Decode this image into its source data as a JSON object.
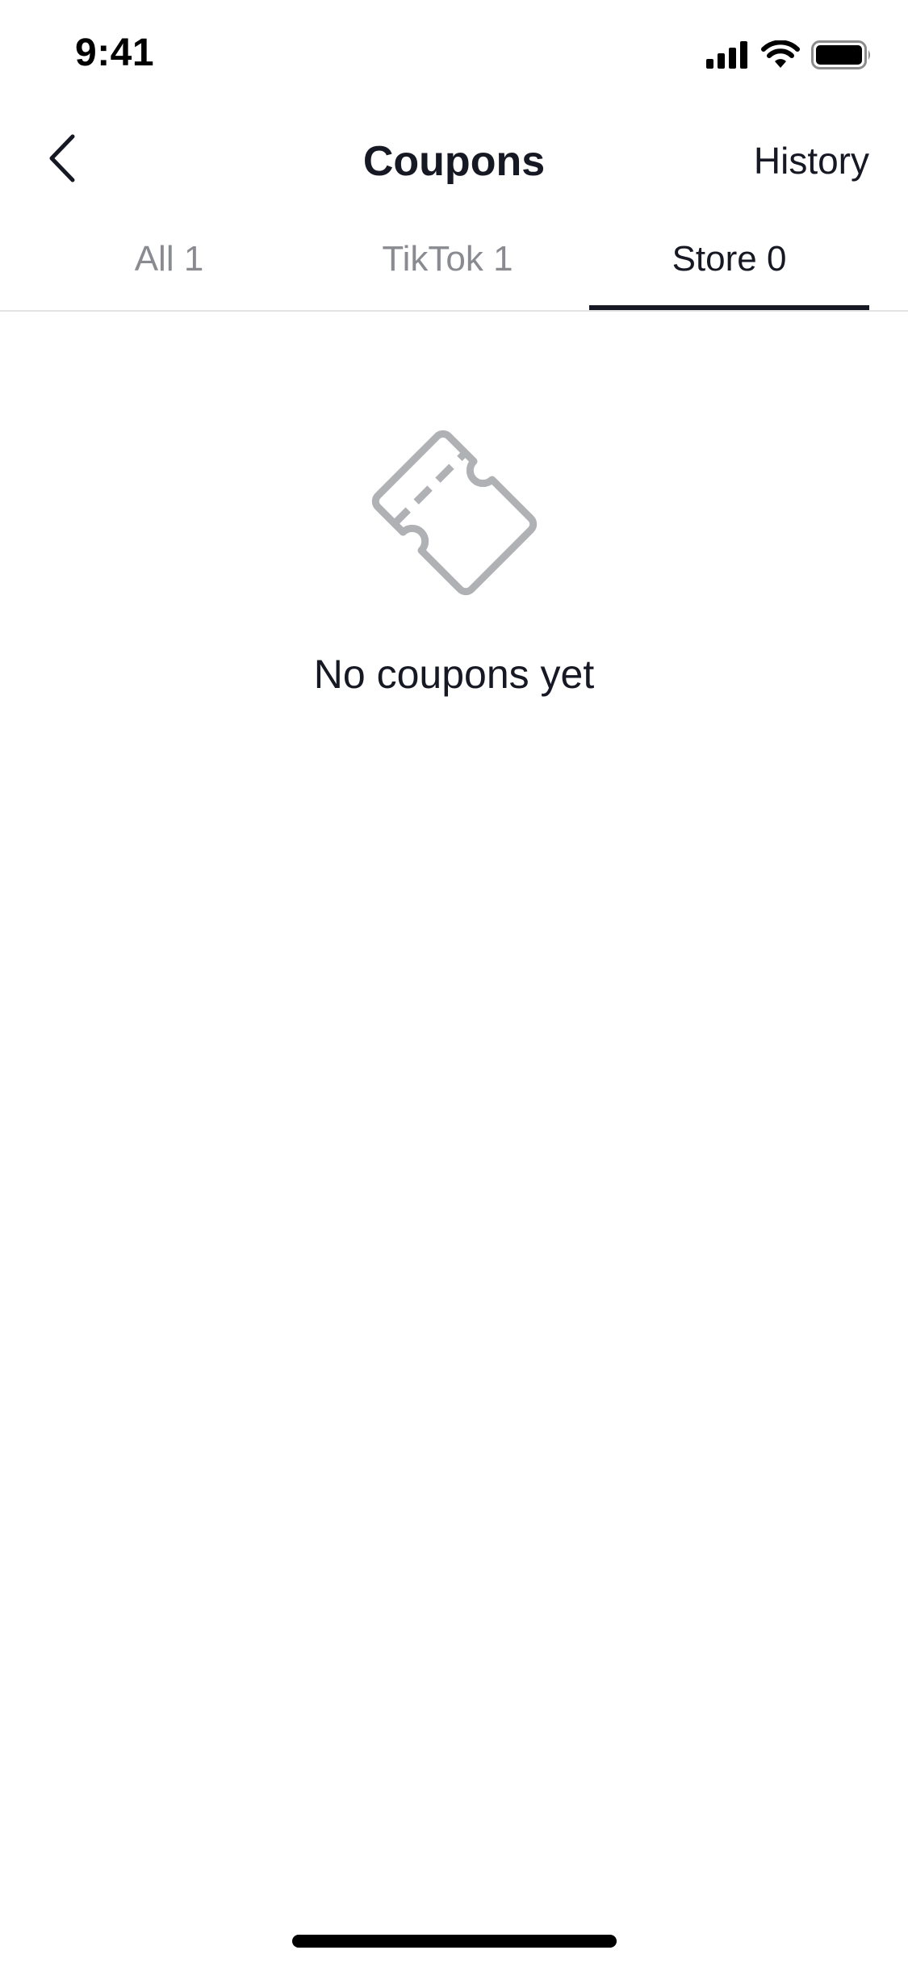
{
  "status_bar": {
    "time": "9:41",
    "icons": [
      "cellular-signal-icon",
      "wifi-icon",
      "battery-icon"
    ]
  },
  "nav": {
    "back_icon": "chevron-left-icon",
    "title": "Coupons",
    "history_label": "History"
  },
  "tabs": [
    {
      "label": "All 1",
      "active": false
    },
    {
      "label": "TikTok 1",
      "active": false
    },
    {
      "label": "Store 0",
      "active": true
    }
  ],
  "empty_state": {
    "icon": "coupon-ticket-icon",
    "message": "No coupons yet"
  },
  "colors": {
    "text_primary": "#161823",
    "text_secondary": "#8a8b91",
    "icon_gray": "#b0b1b4",
    "divider": "#e3e3e4"
  }
}
